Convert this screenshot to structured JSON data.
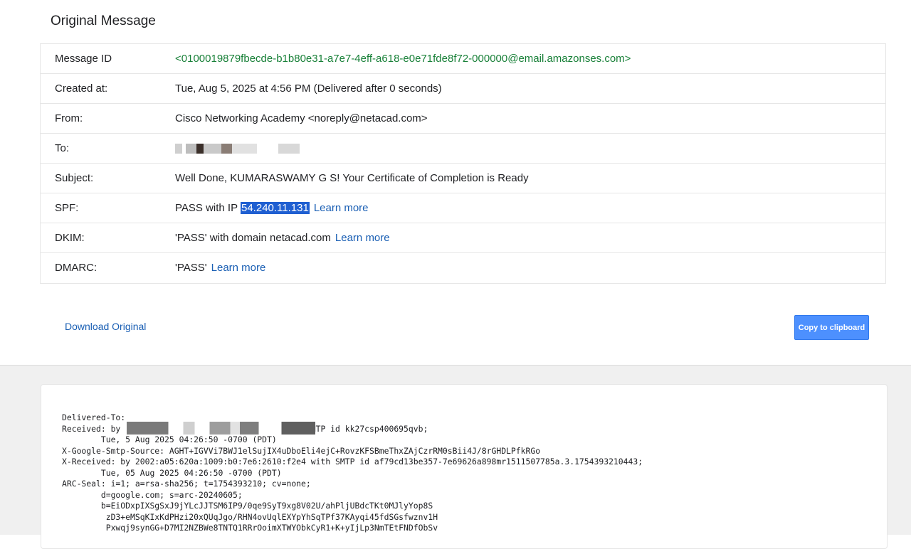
{
  "header": {
    "title": "Original Message"
  },
  "rows": [
    {
      "label": "Message ID",
      "value": "<0100019879fbecde-b1b80e31-a7e7-4eff-a618-e0e71fde8f72-000000@email.amazonses.com>"
    },
    {
      "label": "Created at:",
      "value": "Tue, Aug 5, 2025 at 4:56 PM (Delivered after 0 seconds)"
    },
    {
      "label": "From:",
      "value": "Cisco Networking Academy <noreply@netacad.com>"
    },
    {
      "label": "To:",
      "value": ""
    },
    {
      "label": "Subject:",
      "value": "Well Done, KUMARASWAMY G S! Your Certificate of Completion is Ready"
    },
    {
      "label": "SPF:",
      "value_prefix": "PASS with IP ",
      "value_selected": "54.240.11.131",
      "link": "Learn more"
    },
    {
      "label": "DKIM:",
      "value": "'PASS' with domain netacad.com",
      "link": "Learn more"
    },
    {
      "label": "DMARC:",
      "value": "'PASS'",
      "link": "Learn more"
    }
  ],
  "actions": {
    "download": "Download Original",
    "copy": "Copy to clipboard"
  },
  "raw": {
    "lines": [
      "Delivered-To:",
      "Received: by                                 with SMTP id kk27csp400695qvb;",
      "        Tue, 5 Aug 2025 04:26:50 -0700 (PDT)",
      "X-Google-Smtp-Source: AGHT+IGVVi7BWJ1elSujIX4uDboEli4ejC+RovzKFSBmeThxZAjCzrRM0sBii4J/8rGHDLPfkRGo",
      "X-Received: by 2002:a05:620a:1009:b0:7e6:2610:f2e4 with SMTP id af79cd13be357-7e69626a898mr1511507785a.3.1754393210443;",
      "        Tue, 05 Aug 2025 04:26:50 -0700 (PDT)",
      "ARC-Seal: i=1; a=rsa-sha256; t=1754393210; cv=none;",
      "        d=google.com; s=arc-20240605;",
      "        b=EiODxpIXSgSxJ9jYLcJJTSM6IP9/0qe9SyT9xg8V02U/ahPljUBdcTKt0MJlyYop8S",
      "         zD3+eMSqKIxKdPHzi20xQUqJgo/RHN4ovUqlEXYpYhSqTPf37KAyqi45fdSGsfwznv1H",
      "         Pxwqj9synGG+D7MI2NZBWe8TNTQ1RRrOoimXTWYObkCyR1+K+yIjLp3NmTEtFNDfObSv"
    ]
  },
  "colors": {
    "accent_link": "#1a5fb4",
    "message_id": "#188038",
    "copy_button": "#4d90fe",
    "selection": "#1f5fd1"
  }
}
